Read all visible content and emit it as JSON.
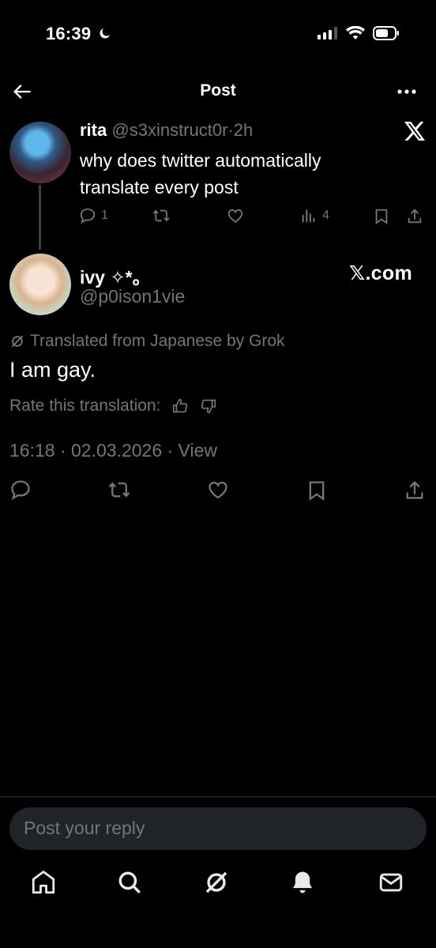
{
  "status_bar": {
    "time": "16:39"
  },
  "header": {
    "title": "Post"
  },
  "quoted_post": {
    "name": "rita",
    "handle": "@s3xinstruct0r",
    "time": "2h",
    "text": "why does twitter automatically translate every post",
    "replies": "1",
    "views": "4"
  },
  "main_post": {
    "name": "ivy ✧*。",
    "handle": "@p0ison1vie",
    "watermark": "𝕏.com",
    "translated_label": "Translated from Japanese by Grok",
    "text": "I am gay.",
    "rate_label": "Rate this translation:",
    "timestamp": "16:18 · 02.03.2026 · View"
  },
  "reply": {
    "placeholder": "Post your reply"
  },
  "icons": {
    "back": "arrow-left-icon",
    "more": "more-horizontal-icon",
    "x_logo": "x-logo-icon",
    "reply": "reply-icon",
    "repost": "repost-icon",
    "like": "heart-icon",
    "views": "views-icon",
    "bookmark": "bookmark-icon",
    "share": "share-icon",
    "grok": "grok-icon",
    "home": "home-icon",
    "search": "search-icon",
    "notifications": "bell-icon",
    "messages": "mail-icon"
  },
  "colors": {
    "background": "#000000",
    "text": "#e7e9ea",
    "muted": "#71767b",
    "reply_box": "#202327"
  }
}
